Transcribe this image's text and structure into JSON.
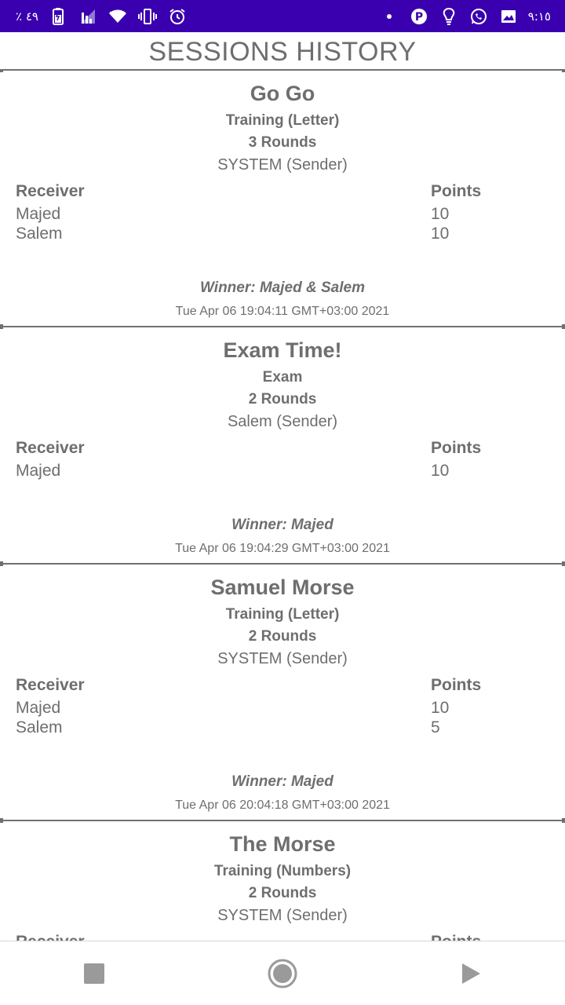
{
  "status_bar": {
    "battery_text": "٪ ٤٩",
    "time": "٩:١٥",
    "left_icons": [
      "battery-icon",
      "signal-icon",
      "wifi-icon",
      "vibrate-icon",
      "alarm-icon"
    ],
    "right_icons": [
      "dot-icon",
      "parking-app-icon",
      "bulb-icon",
      "whatsapp-icon",
      "gallery-icon"
    ],
    "background": "#3a00b0"
  },
  "page": {
    "title": "SESSIONS HISTORY"
  },
  "table_headers": {
    "receiver": "Receiver",
    "points": "Points"
  },
  "sessions": [
    {
      "title": "Go Go",
      "mode": "Training (Letter)",
      "rounds": "3 Rounds",
      "sender": "SYSTEM (Sender)",
      "rows": [
        {
          "receiver": "Majed",
          "points": "10"
        },
        {
          "receiver": "Salem",
          "points": "10"
        }
      ],
      "winner": "Winner: Majed & Salem",
      "date": "Tue Apr 06 19:04:11 GMT+03:00 2021"
    },
    {
      "title": "Exam Time!",
      "mode": "Exam",
      "rounds": "2 Rounds",
      "sender": "Salem (Sender)",
      "rows": [
        {
          "receiver": "Majed",
          "points": "10"
        }
      ],
      "winner": "Winner: Majed",
      "date": "Tue Apr 06 19:04:29 GMT+03:00 2021"
    },
    {
      "title": "Samuel Morse",
      "mode": "Training (Letter)",
      "rounds": "2 Rounds",
      "sender": "SYSTEM (Sender)",
      "rows": [
        {
          "receiver": "Majed",
          "points": "10"
        },
        {
          "receiver": "Salem",
          "points": "5"
        }
      ],
      "winner": "Winner: Majed",
      "date": "Tue Apr 06 20:04:18 GMT+03:00 2021"
    },
    {
      "title": "The Morse",
      "mode": "Training (Numbers)",
      "rounds": "2 Rounds",
      "sender": "SYSTEM (Sender)",
      "rows": [],
      "winner": "",
      "date": ""
    }
  ],
  "nav": {
    "buttons": [
      "stop-icon",
      "home-icon",
      "back-icon"
    ]
  },
  "colors": {
    "accent": "#3a00b0",
    "text": "#6e6e6e",
    "divider": "#707070"
  }
}
